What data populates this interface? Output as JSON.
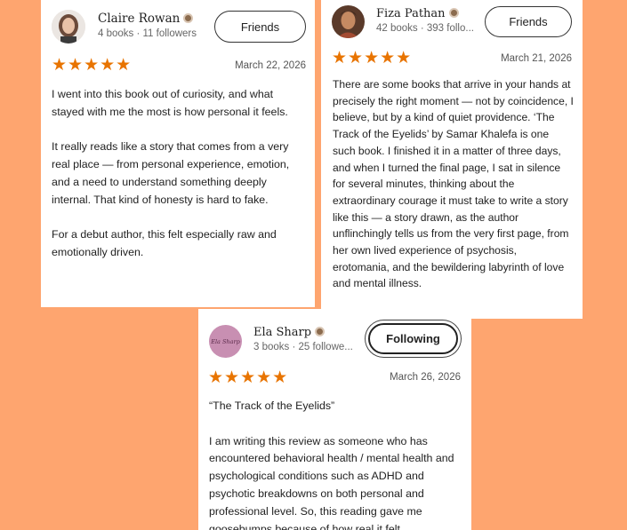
{
  "reviews": [
    {
      "name": "Claire Rowan",
      "meta": "4 books · 11 followers",
      "button": "Friends",
      "stars": "★★★★★",
      "rating": 5,
      "date": "March 22, 2026",
      "paragraphs": [
        "I went into this book out of curiosity, and what stayed with me the most is how personal it feels.",
        "It really reads like a story that comes from a very real place — from personal experience, emotion, and a need to understand something deeply internal. That kind of honesty is hard to fake.",
        "For a debut author, this felt especially raw and emotionally driven."
      ]
    },
    {
      "name": "Fiza Pathan",
      "meta": "42 books · 393 follo...",
      "button": "Friends",
      "stars": "★★★★★",
      "rating": 5,
      "date": "March 21, 2026",
      "paragraphs": [
        "There are some books that arrive in your hands at precisely the right moment — not by coincidence, I believe, but by a kind of quiet providence. ‘The Track of the Eyelids’ by Samar Khalefa is one such book. I finished it in a matter of three days, and when I turned the final page, I sat in silence for several minutes, thinking about the extraordinary courage it must take to write a story like this — a story drawn, as the author unflinchingly tells us from the very first page, from her own lived experience of psychosis, erotomania, and the bewildering labyrinth of love and mental illness."
      ]
    },
    {
      "name": "Ela Sharp",
      "meta": "3 books · 25 followe...",
      "button": "Following",
      "avatar_text": "Ela Sharp",
      "stars": "★★★★★",
      "rating": 5,
      "date": "March 26, 2026",
      "paragraphs": [
        "“The Track of the Eyelids”",
        "I am writing this review as someone who has encountered behavioral health / mental health and psychological conditions such as ADHD and psychotic breakdowns on both personal and professional level. So, this reading gave me goosebumps because of how real it felt."
      ]
    }
  ],
  "colors": {
    "background": "#fea56f",
    "star": "#e87400",
    "card": "#ffffff"
  }
}
